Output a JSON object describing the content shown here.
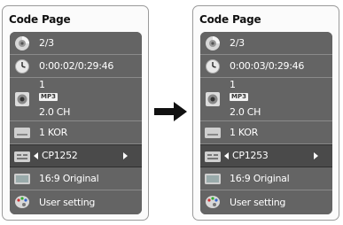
{
  "panels": [
    {
      "title": "Code Page",
      "rows": {
        "title_number": "2/3",
        "time": "0:00:02/0:29:46",
        "audio_track": "1",
        "audio_format": "MP3",
        "audio_channels": "2.0 CH",
        "subtitle": "1 KOR",
        "code_page": "CP1252",
        "aspect": "16:9 Original",
        "picture_mode": "User setting"
      }
    },
    {
      "title": "Code Page",
      "rows": {
        "title_number": "2/3",
        "time": "0:00:03/0:29:46",
        "audio_track": "1",
        "audio_format": "MP3",
        "audio_channels": "2.0 CH",
        "subtitle": "1 KOR",
        "code_page": "CP1253",
        "aspect": "16:9 Original",
        "picture_mode": "User setting"
      }
    }
  ],
  "icons": {
    "title": "disc-icon",
    "time": "clock-icon",
    "audio": "speaker-icon",
    "subtitle": "subtitle-icon",
    "code_page": "code-page-icon",
    "aspect": "screen-icon",
    "picture_mode": "picture-mode-icon",
    "transition": "right-arrow-icon"
  },
  "colors": {
    "row_bg": "#646464",
    "selected_row_bg": "#4a4a4a",
    "text": "#ffffff"
  }
}
